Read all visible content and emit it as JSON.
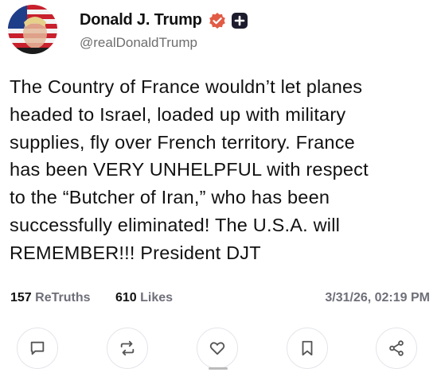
{
  "post": {
    "display_name": "Donald J. Trump",
    "handle": "@realDonaldTrump",
    "verified": true,
    "lines": [
      "The Country of France wouldn’t let planes",
      "headed to Israel, loaded up with military",
      "supplies, fly over French territory. France",
      "has been VERY UNHELPFUL with respect",
      "to the “Butcher of Iran,” who has been",
      "successfully eliminated! The U.S.A. will",
      "REMEMBER!!! President DJT"
    ],
    "retruths_count": "157",
    "retruths_label": "ReTruths",
    "likes_count": "610",
    "likes_label": "Likes",
    "timestamp": "3/31/26, 02:19 PM"
  },
  "actions": [
    {
      "name": "reply",
      "icon": "comment-icon"
    },
    {
      "name": "retruth",
      "icon": "retruth-icon"
    },
    {
      "name": "like",
      "icon": "heart-icon"
    },
    {
      "name": "bookmark",
      "icon": "bookmark-icon"
    },
    {
      "name": "share",
      "icon": "share-icon"
    }
  ],
  "colors": {
    "verified_badge": "#e25b45",
    "muted_text": "#6f6f7a",
    "action_border": "#e4e5ea"
  }
}
